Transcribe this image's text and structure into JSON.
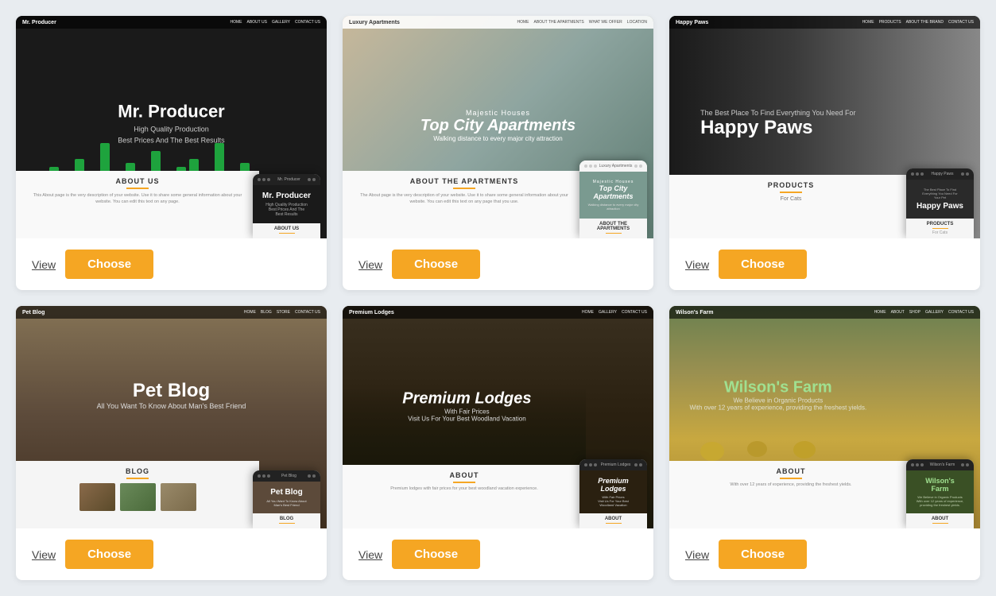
{
  "cards": [
    {
      "id": "mr-producer",
      "title": "Mr. Producer",
      "subtitle": "High Quality Production",
      "description": "Best Prices And The Best Results",
      "nav_title": "Mr. Producer",
      "nav_links": [
        "HOME",
        "ABOUT US",
        "GALLERY",
        "CONTACT US"
      ],
      "section_label": "ABOUT US",
      "section_text": "This About page is the very description of your website. Use it to share some general information about your website. You can edit this text on any page.",
      "mobile_title": "Mr. Producer",
      "mobile_sub": "High Quality Production\nBest Prices And The\nBest Results",
      "mobile_section": "ABOUT US",
      "theme": "dark",
      "view_label": "View",
      "choose_label": "Choose"
    },
    {
      "id": "luxury-apartments",
      "title": "Top City Apartments",
      "subtitle": "Majestic Houses",
      "description": "Walking distance to every major city attraction",
      "nav_title": "Luxury Apartments",
      "nav_links": [
        "HOME",
        "ABOUT THE APARTMENTS",
        "WHAT WE OFFER",
        "LOCATION"
      ],
      "section_label": "ABOUT THE APARTMENTS",
      "section_text": "The About page is the very description of your website. Use it to share some general information about your website. You can edit this text on any page that you use.",
      "mobile_title": "Top City\nApartments",
      "mobile_sub": "Walking distance to\nevery major city attraction",
      "mobile_section": "ABOUT THE APARTMENTS",
      "theme": "teal",
      "view_label": "View",
      "choose_label": "Choose"
    },
    {
      "id": "happy-paws",
      "title": "Happy Paws",
      "subtitle": "The Best Place To Find Everything You Need For",
      "description": "The Best Place To Find Everything You Need For Your Pet",
      "nav_title": "Happy Paws",
      "nav_links": [
        "HOME",
        "PRODUCTS",
        "ABOUT THE BRAND",
        "CONTACT US"
      ],
      "section_label": "PRODUCTS",
      "section_sublabel": "For Cats",
      "mobile_title": "Happy Paws",
      "mobile_sub": "The Best Place To Find\nEverything You Need For\nYour Pet",
      "theme": "dark-pet",
      "view_label": "View",
      "choose_label": "Choose"
    },
    {
      "id": "pet-blog",
      "title": "Pet Blog",
      "subtitle": "All You Want To Know About Man's Best Friend",
      "nav_title": "Pet Blog",
      "nav_links": [
        "HOME",
        "BLOG",
        "STORE",
        "CONTACT US"
      ],
      "section_label": "BLOG",
      "mobile_title": "Pet Blog",
      "mobile_sub": "All You Want To Know About\nMan's Best Friend",
      "mobile_section": "BLOG",
      "theme": "forest",
      "view_label": "View",
      "choose_label": "Choose"
    },
    {
      "id": "premium-lodges",
      "title": "Premium Lodges",
      "subtitle": "With Fair Prices",
      "description": "Visit Us For Your Best Woodland Vacation",
      "nav_title": "Premium Lodges",
      "nav_links": [
        "HOME",
        "GALLERY",
        "CONTACT US"
      ],
      "section_label": "ABOUT",
      "mobile_title": "Premium\nLodges",
      "mobile_sub": "With Fair Prices\nVisit Us For Your Best\nWoodland Vacation",
      "theme": "lodge",
      "view_label": "View",
      "choose_label": "Choose"
    },
    {
      "id": "wilsons-farm",
      "title": "Wilson's Farm",
      "subtitle": "We Believe in Organic Products",
      "description": "With over 12 years of experience, providing the freshest yields.",
      "nav_title": "Wilson's Farm",
      "nav_links": [
        "HOME",
        "ABOUT",
        "SHOP",
        "GALLERY",
        "CONTACT US"
      ],
      "section_label": "ABOUT",
      "mobile_title": "Wilson's\nFarm",
      "mobile_sub": "We Believe in Organic Products\nWith over 12 years of experience, providing the freshest yields.",
      "theme": "farm",
      "view_label": "View",
      "choose_label": "Choose"
    }
  ],
  "accent_color": "#f5a623"
}
